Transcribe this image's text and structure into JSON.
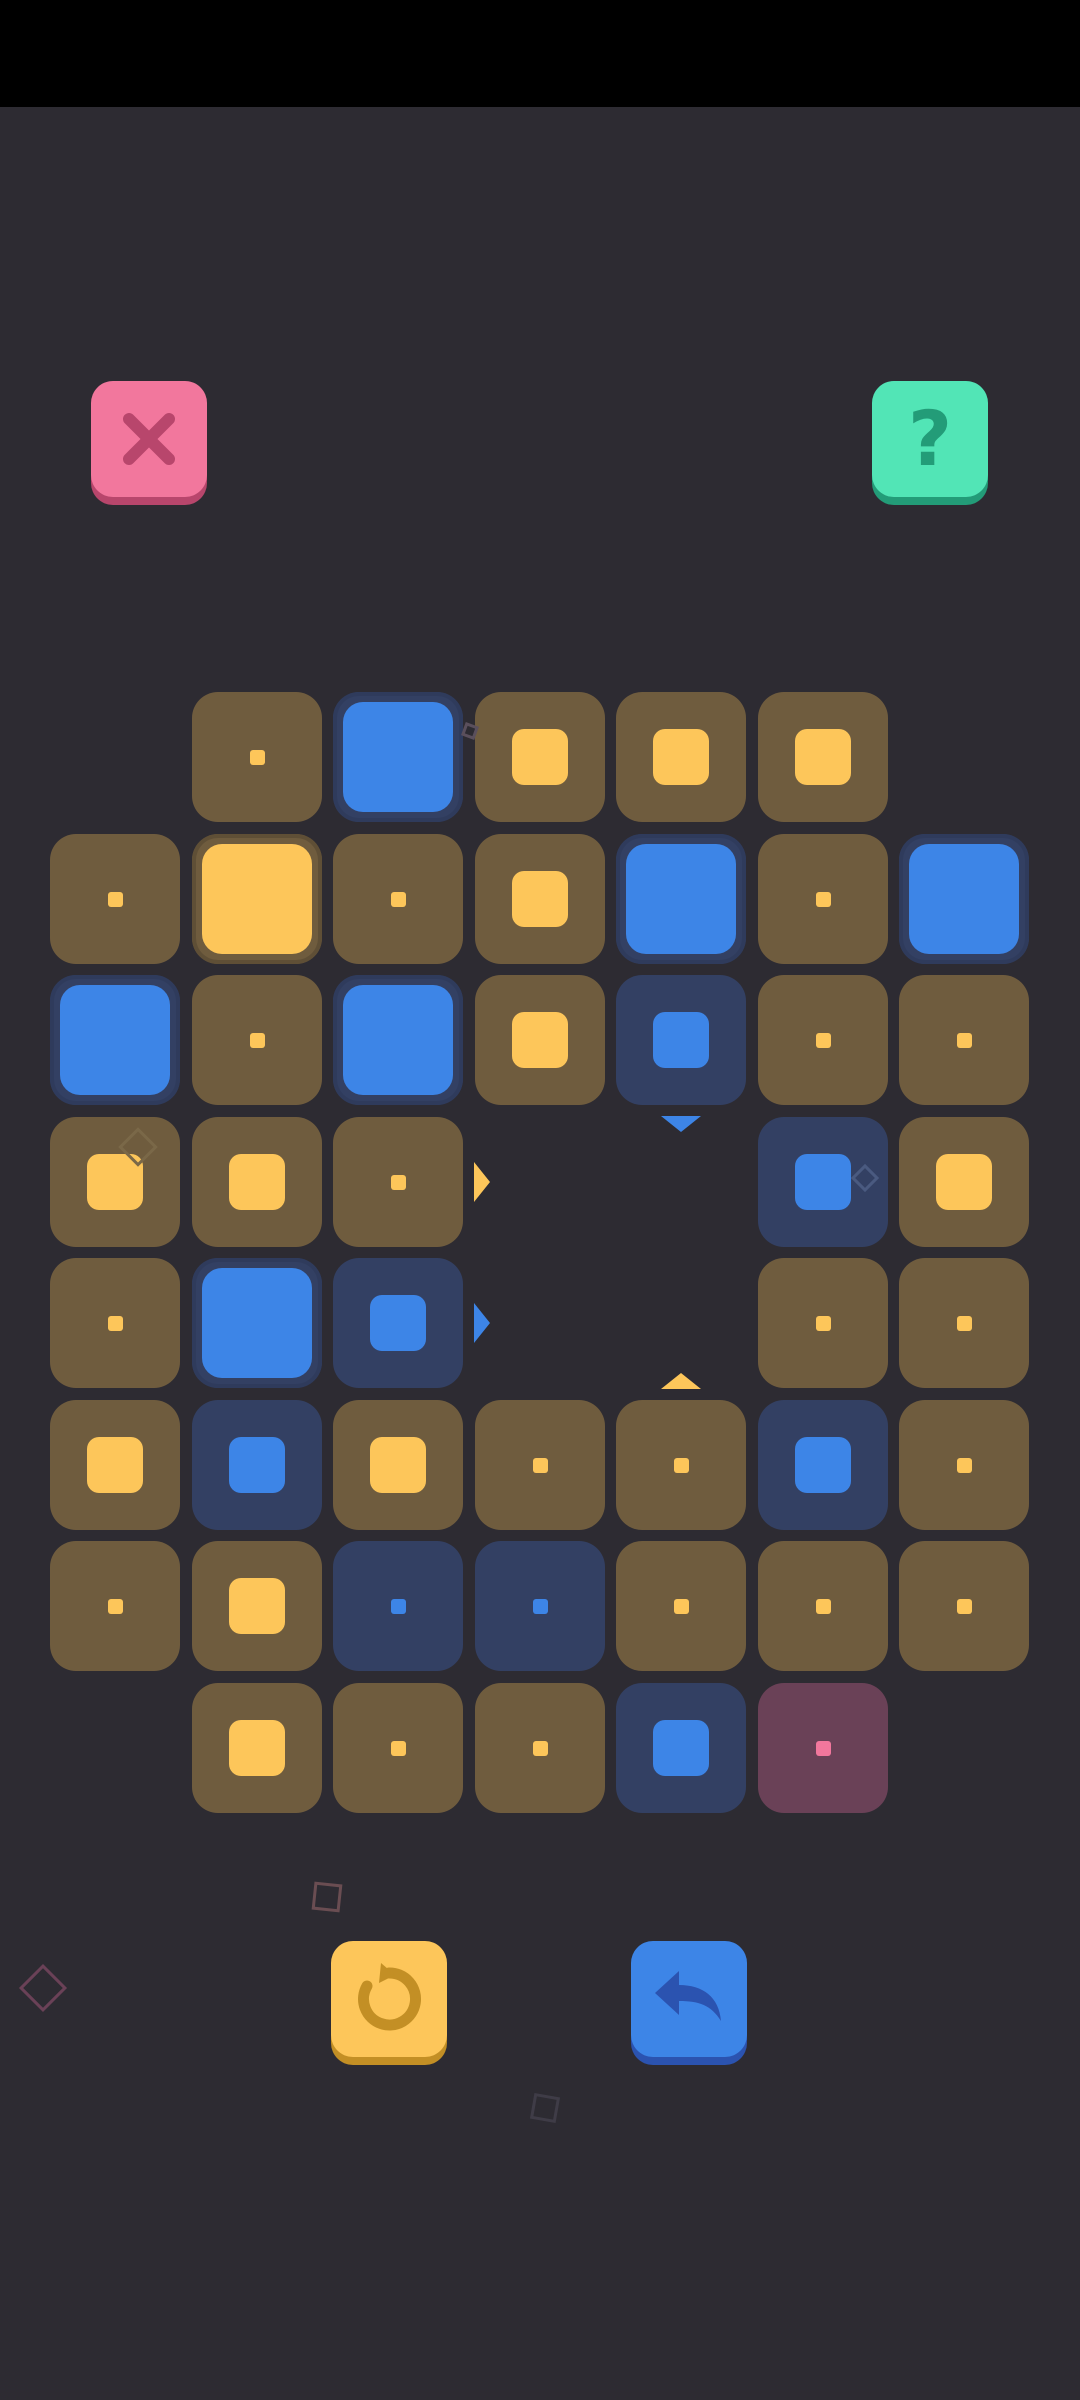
{
  "toolbar": {
    "close_icon": "close-x-icon",
    "help_label": "?",
    "restart_icon": "restart-icon",
    "undo_icon": "undo-arrow-icon"
  },
  "colors": {
    "background": "#2d2b32",
    "yellow": "#fdc65a",
    "yellow_tile": "#6f5c3e",
    "blue": "#3d85e7",
    "blue_tile": "#334063",
    "pink": "#f2779d",
    "pink_tile": "#6a4157",
    "green": "#52e5b6"
  },
  "board": {
    "columns": 7,
    "rows": 8,
    "cells": [
      {
        "row": 0,
        "col": 1,
        "tile": "yellow",
        "marker": "dot"
      },
      {
        "row": 0,
        "col": 2,
        "tile": "blue",
        "marker": "large"
      },
      {
        "row": 0,
        "col": 3,
        "tile": "yellow",
        "marker": "medium"
      },
      {
        "row": 0,
        "col": 4,
        "tile": "yellow",
        "marker": "medium"
      },
      {
        "row": 0,
        "col": 5,
        "tile": "yellow",
        "marker": "medium"
      },
      {
        "row": 1,
        "col": 0,
        "tile": "yellow",
        "marker": "dot"
      },
      {
        "row": 1,
        "col": 1,
        "tile": "yellow",
        "marker": "large"
      },
      {
        "row": 1,
        "col": 2,
        "tile": "yellow",
        "marker": "dot"
      },
      {
        "row": 1,
        "col": 3,
        "tile": "yellow",
        "marker": "medium"
      },
      {
        "row": 1,
        "col": 4,
        "tile": "blue",
        "marker": "large"
      },
      {
        "row": 1,
        "col": 5,
        "tile": "yellow",
        "marker": "dot"
      },
      {
        "row": 1,
        "col": 6,
        "tile": "blue",
        "marker": "large"
      },
      {
        "row": 2,
        "col": 0,
        "tile": "blue",
        "marker": "large"
      },
      {
        "row": 2,
        "col": 1,
        "tile": "yellow",
        "marker": "dot"
      },
      {
        "row": 2,
        "col": 2,
        "tile": "blue",
        "marker": "large"
      },
      {
        "row": 2,
        "col": 3,
        "tile": "yellow",
        "marker": "medium"
      },
      {
        "row": 2,
        "col": 4,
        "tile": "blue",
        "marker": "medium"
      },
      {
        "row": 2,
        "col": 5,
        "tile": "yellow",
        "marker": "dot"
      },
      {
        "row": 2,
        "col": 6,
        "tile": "yellow",
        "marker": "dot"
      },
      {
        "row": 3,
        "col": 0,
        "tile": "yellow",
        "marker": "medium"
      },
      {
        "row": 3,
        "col": 1,
        "tile": "yellow",
        "marker": "medium"
      },
      {
        "row": 3,
        "col": 2,
        "tile": "yellow",
        "marker": "dot"
      },
      {
        "row": 3,
        "col": 5,
        "tile": "blue",
        "marker": "medium"
      },
      {
        "row": 3,
        "col": 6,
        "tile": "yellow",
        "marker": "medium"
      },
      {
        "row": 4,
        "col": 0,
        "tile": "yellow",
        "marker": "dot"
      },
      {
        "row": 4,
        "col": 1,
        "tile": "blue",
        "marker": "large"
      },
      {
        "row": 4,
        "col": 2,
        "tile": "blue",
        "marker": "medium"
      },
      {
        "row": 4,
        "col": 5,
        "tile": "yellow",
        "marker": "dot"
      },
      {
        "row": 4,
        "col": 6,
        "tile": "yellow",
        "marker": "dot"
      },
      {
        "row": 5,
        "col": 0,
        "tile": "yellow",
        "marker": "medium"
      },
      {
        "row": 5,
        "col": 1,
        "tile": "blue",
        "marker": "medium"
      },
      {
        "row": 5,
        "col": 2,
        "tile": "yellow",
        "marker": "medium"
      },
      {
        "row": 5,
        "col": 3,
        "tile": "yellow",
        "marker": "dot"
      },
      {
        "row": 5,
        "col": 4,
        "tile": "yellow",
        "marker": "dot"
      },
      {
        "row": 5,
        "col": 5,
        "tile": "blue",
        "marker": "medium"
      },
      {
        "row": 5,
        "col": 6,
        "tile": "yellow",
        "marker": "dot"
      },
      {
        "row": 6,
        "col": 0,
        "tile": "yellow",
        "marker": "dot"
      },
      {
        "row": 6,
        "col": 1,
        "tile": "yellow",
        "marker": "medium"
      },
      {
        "row": 6,
        "col": 2,
        "tile": "blue",
        "marker": "dot"
      },
      {
        "row": 6,
        "col": 3,
        "tile": "blue",
        "marker": "dot"
      },
      {
        "row": 6,
        "col": 4,
        "tile": "yellow",
        "marker": "dot"
      },
      {
        "row": 6,
        "col": 5,
        "tile": "yellow",
        "marker": "dot"
      },
      {
        "row": 6,
        "col": 6,
        "tile": "yellow",
        "marker": "dot"
      },
      {
        "row": 7,
        "col": 1,
        "tile": "yellow",
        "marker": "medium"
      },
      {
        "row": 7,
        "col": 2,
        "tile": "yellow",
        "marker": "dot"
      },
      {
        "row": 7,
        "col": 3,
        "tile": "yellow",
        "marker": "dot"
      },
      {
        "row": 7,
        "col": 4,
        "tile": "blue",
        "marker": "medium"
      },
      {
        "row": 7,
        "col": 5,
        "tile": "pink",
        "marker": "dot"
      }
    ],
    "arrows": [
      {
        "name": "arrow-right-yellow",
        "color": "yellow",
        "direction": "right",
        "row": 3,
        "col": 2
      },
      {
        "name": "arrow-right-blue",
        "color": "blue",
        "direction": "right",
        "row": 4,
        "col": 2
      },
      {
        "name": "arrow-down-blue",
        "color": "blue",
        "direction": "down",
        "row": 2,
        "col": 4
      },
      {
        "name": "arrow-up-yellow",
        "color": "yellow",
        "direction": "up",
        "row": 5,
        "col": 4
      }
    ]
  }
}
